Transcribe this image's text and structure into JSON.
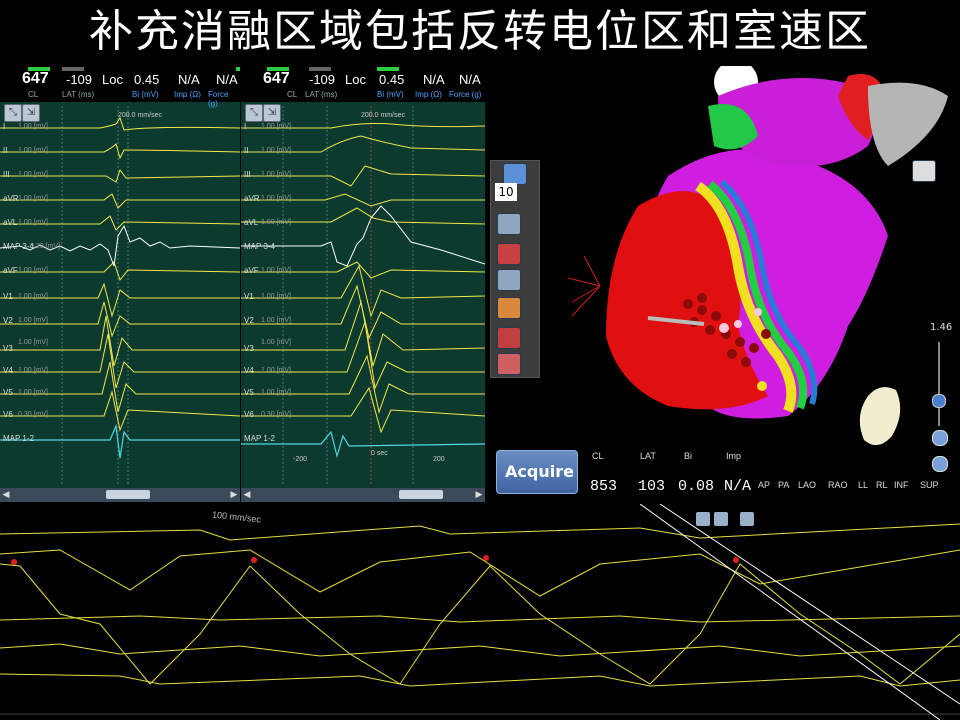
{
  "title": "补充消融区域包括反转电位区和室速区",
  "egm_left": {
    "cl": "647",
    "cl_label": "CL",
    "lat": "-109",
    "lat_label": "LAT (ms)",
    "loc": "Loc",
    "bi": "0.45",
    "bi_label": "Bi (mV)",
    "imp": "N/A",
    "imp_label": "Imp (Ω)",
    "force": "N/A",
    "force_label": "Force (g)",
    "speed": "200.0 mm/sec",
    "leads": [
      {
        "name": "I",
        "gain": "1.00 [mV]"
      },
      {
        "name": "II",
        "gain": "1.00 [mV]"
      },
      {
        "name": "III",
        "gain": "1.00 [mV]"
      },
      {
        "name": "aVR",
        "gain": "1.00 [mV]"
      },
      {
        "name": "aVL",
        "gain": "1.00 [mV]"
      },
      {
        "name": "MAP 3-4",
        "gain": "0.20 [mV]"
      },
      {
        "name": "aVF",
        "gain": "1.00 [mV]"
      },
      {
        "name": "V1",
        "gain": "1.00 [mV]"
      },
      {
        "name": "V2",
        "gain": "1.00 [mV]"
      },
      {
        "name": "V3",
        "gain": "1.00 [mV]"
      },
      {
        "name": "V4",
        "gain": "1.00 [mV]"
      },
      {
        "name": "V5",
        "gain": "1.00 [mV]"
      },
      {
        "name": "V6",
        "gain": "0.30 [mV]"
      },
      {
        "name": "MAP 1-2",
        "gain": ""
      }
    ]
  },
  "egm_right": {
    "cl": "647",
    "cl_label": "CL",
    "lat": "-109",
    "lat_label": "LAT (ms)",
    "loc": "Loc",
    "bi": "0.45",
    "bi_label": "Bi (mV)",
    "imp": "N/A",
    "imp_label": "Imp (Ω)",
    "force": "N/A",
    "force_label": "Force (g)",
    "speed": "200.0 mm/sec",
    "axis_left": "-200",
    "axis_mid": "0 sec",
    "axis_right": "200"
  },
  "map": {
    "toolbar_number": "10",
    "acquire_label": "Acquire",
    "readout": {
      "cl_label": "CL",
      "cl": "853",
      "lat_label": "LAT",
      "lat": "103",
      "bi_label": "Bi",
      "bi": "0.08",
      "imp_label": "Imp",
      "imp": "N/A"
    },
    "views": [
      "AP",
      "PA",
      "LAO",
      "RAO",
      "LL",
      "RL",
      "INF",
      "SUP"
    ],
    "zoom": "1.46"
  },
  "strip": {
    "speed": "100 mm/sec"
  },
  "colors": {
    "trace": "#f2e84a",
    "map_trace": "#5fd0e0",
    "panel_bg": "#0c3a2e"
  }
}
